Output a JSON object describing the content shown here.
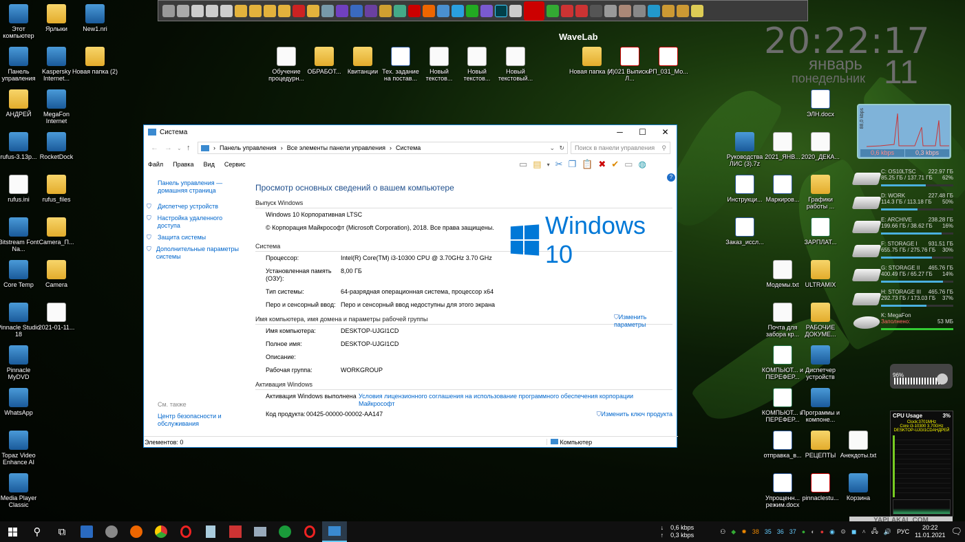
{
  "desktop": {
    "clock": "20:22:17",
    "month": "январь",
    "weekday": "понедельник",
    "day": "11",
    "left_icons": [
      "Этот компьютер",
      "Ярлыки",
      "New1.nri",
      "Панель управления",
      "Kaspersky Internet...",
      "Новая папка (2)",
      "АНДРЕЙ",
      "MegaFon Internet",
      "rufus-3.13p...",
      "RocketDock",
      "rufus.ini",
      "rufus_files",
      "Bitstream Font Na...",
      "Camera_П...",
      "Core Temp",
      "Camera",
      "Pinnacle Studio 18",
      "2021-01-11...",
      "Pinnacle MyDVD",
      "WhatsApp",
      "Topaz Video Enhance AI",
      "Media Player Classic"
    ],
    "top_icons": [
      "Обучение процедурн...",
      "ОБРАБОТ...",
      "Квитанции",
      "Тех. задание на постав...",
      "Новый текстов...",
      "Новый текстов...",
      "Новый текстовый...",
      "Новая папка (4)",
      "И.021 Выписка Л...",
      "РП_031_Мо..."
    ],
    "right_icons": [
      "ЭЛН.docx",
      "Руководства ЛИС (3).7z",
      "2021_ЯНВ...",
      "2020_ДЕКА...",
      "Инструкци...",
      "Маркиров...",
      "Графики работы ...",
      "Заказ_иссл...",
      "ЗАРПЛАТ...",
      "Модемы.txt",
      "ULTRAMIX",
      "Почта для забора кр...",
      "РАБОЧИЕ ДОКУМЕ...",
      "КОМПЬЮТ... и ПЕРЕФЕР...",
      "Диспетчер устройств",
      "КОМПЬЮТ... и ПЕРЕФЕР...",
      "Программы и компоне...",
      "отправка_в...",
      "РЕЦЕПТЫ",
      "Анекдоты.txt",
      "Упрощенн... режим.docx",
      "pinnaclestu...",
      "Корзина"
    ],
    "wavelab": "WaveLab",
    "net_down": "0,6 kbps",
    "net_up": "0,3 kbps",
    "net_axis": "88,0 kbps",
    "drives": [
      {
        "name": "C: OS10LTSC",
        "size": "222.97 ГБ",
        "used": "85.25 ГБ / 137.71 ГБ",
        "pct": "62%",
        "fill": 0.62
      },
      {
        "name": "D: WORK",
        "size": "227.48 ГБ",
        "used": "114.3 ГБ / 113.18 ГБ",
        "pct": "50%",
        "fill": 0.5
      },
      {
        "name": "E: ARCHIVE",
        "size": "238.28 ГБ",
        "used": "199.66 ГБ / 38.62 ГБ",
        "pct": "16%",
        "fill": 0.84
      },
      {
        "name": "F: STORAGE I",
        "size": "931.51 ГБ",
        "used": "655.75 ГБ / 275.76 ГБ",
        "pct": "30%",
        "fill": 0.7
      },
      {
        "name": "G: STORAGE II",
        "size": "465.76 ГБ",
        "used": "400.49 ГБ / 65.27 ГБ",
        "pct": "14%",
        "fill": 0.86
      },
      {
        "name": "H: STORAGE III",
        "size": "465.76 ГБ",
        "used": "292.73 ГБ / 173.03 ГБ",
        "pct": "37%",
        "fill": 0.63
      }
    ],
    "megafon_drive": {
      "name": "K: MegaFon",
      "line2": "Заполнено:",
      "size": "53 МБ"
    },
    "volume": "96%",
    "cpu_widget": {
      "title": "CPU Usage",
      "pct": "3%",
      "clock": "Clock:3701MHz",
      "cpu": "Core i3-10300 3.70GHz",
      "host": "DESKTOP-UJGI1CDАНДРЕЙ"
    },
    "watermark": "YAPLAKAL.COM"
  },
  "window": {
    "title": "Система",
    "breadcrumb": [
      "Панель управления",
      "Все элементы панели управления",
      "Система"
    ],
    "search_placeholder": "Поиск в панели управления",
    "menu": [
      "Файл",
      "Правка",
      "Вид",
      "Сервис"
    ],
    "left": {
      "home": "Панель управления — домашняя страница",
      "links": [
        "Диспетчер устройств",
        "Настройка удаленного доступа",
        "Защита системы",
        "Дополнительные параметры системы"
      ],
      "see_also": "См. также",
      "security": "Центр безопасности и обслуживания"
    },
    "heading": "Просмотр основных сведений о вашем компьютере",
    "edition_section": "Выпуск Windows",
    "edition": "Windows 10 Корпоративная LTSC",
    "copyright": "© Корпорация Майкрософт (Microsoft Corporation), 2018. Все права защищены.",
    "logo_text": "Windows 10",
    "system_section": "Система",
    "system_rows": [
      {
        "k": "Процессор:",
        "v": "Intel(R) Core(TM) i3-10300 CPU @ 3.70GHz   3.70 GHz"
      },
      {
        "k": "Установленная память (ОЗУ):",
        "v": "8,00 ГБ"
      },
      {
        "k": "Тип системы:",
        "v": "64-разрядная операционная система, процессор x64"
      },
      {
        "k": "Перо и сенсорный ввод:",
        "v": "Перо и сенсорный ввод недоступны для этого экрана"
      }
    ],
    "name_section": "Имя компьютера, имя домена и параметры рабочей группы",
    "name_rows": [
      {
        "k": "Имя компьютера:",
        "v": "DESKTOP-UJGI1CD"
      },
      {
        "k": "Полное имя:",
        "v": "DESKTOP-UJGI1CD"
      },
      {
        "k": "Описание:",
        "v": ""
      },
      {
        "k": "Рабочая группа:",
        "v": "WORKGROUP"
      }
    ],
    "change_params": "Изменить параметры",
    "activation_section": "Активация Windows",
    "activation_label": "Активация Windows выполнена",
    "license_link": "Условия лицензионного соглашения на использование программного обеспечения корпорации Майкрософт",
    "product_label": "Код продукта:",
    "product_code": "00425-00000-00002-AA147",
    "change_key": "Изменить ключ продукта",
    "status_items": "Элементов: 0",
    "status_location": "Компьютер"
  },
  "taskbar": {
    "net_down": "0,6 kbps",
    "net_up": "0,3 kbps",
    "temps": [
      "38",
      "35",
      "36",
      "37"
    ],
    "lang": "РУС",
    "time": "20:22",
    "date": "11.01.2021"
  }
}
